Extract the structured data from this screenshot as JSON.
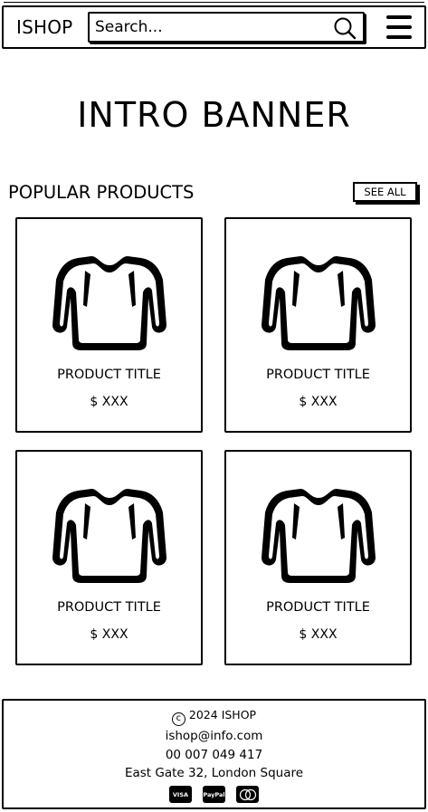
{
  "header": {
    "logo": "ISHOP",
    "search_placeholder": "Search...",
    "search_icon": "magnifier-icon",
    "menu_icon": "hamburger-icon"
  },
  "banner": {
    "title": "INTRO BANNER"
  },
  "popular": {
    "heading": "POPULAR PRODUCTS",
    "see_all_label": "SEE ALL",
    "products": [
      {
        "title": "PRODUCT TITLE",
        "price": "$ XXX",
        "image_icon": "sweater-icon"
      },
      {
        "title": "PRODUCT TITLE",
        "price": "$ XXX",
        "image_icon": "sweater-icon"
      },
      {
        "title": "PRODUCT TITLE",
        "price": "$ XXX",
        "image_icon": "sweater-icon"
      },
      {
        "title": "PRODUCT TITLE",
        "price": "$ XXX",
        "image_icon": "sweater-icon"
      }
    ]
  },
  "footer": {
    "copyright": "2024 ISHOP",
    "email": "ishop@info.com",
    "phone": "00 007 049 417",
    "address": "East Gate 32, London Square",
    "payment_methods": [
      "VISA",
      "PayPal",
      "mastercard"
    ]
  }
}
